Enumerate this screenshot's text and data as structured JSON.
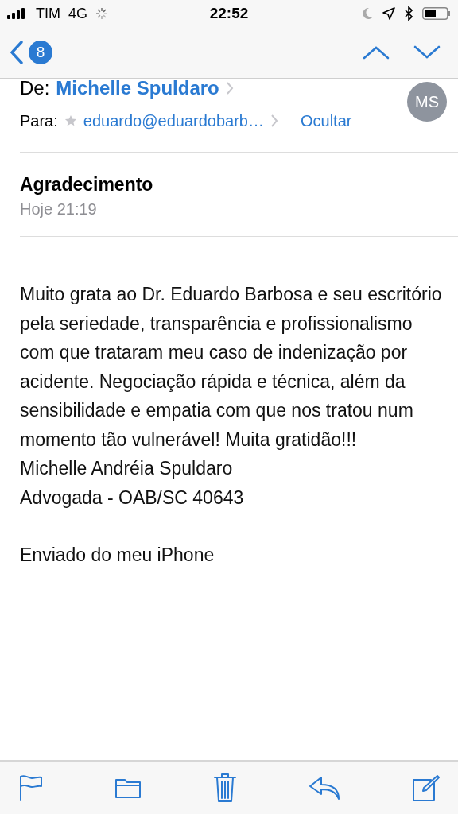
{
  "status_bar": {
    "carrier": "TIM",
    "network": "4G",
    "time": "22:52"
  },
  "nav": {
    "unread_count": "8"
  },
  "header": {
    "from_label": "De:",
    "from": "Michelle Spuldaro",
    "to_label": "Para:",
    "to": "eduardo@eduardobarb…",
    "hide": "Ocultar",
    "avatar": "MS",
    "subject": "Agradecimento",
    "date": "Hoje 21:19"
  },
  "body": {
    "paragraph": "Muito grata ao Dr. Eduardo Barbosa e seu escritório pela seriedade, transparência e profissionalismo com que trataram meu caso de indenização por acidente. Negociação rápida e técnica, além da sensibilidade e empatia com que nos tratou num momento tão vulnerável! Muita gratidão!!!",
    "signature": [
      "Michelle Andréia Spuldaro",
      "Advogada - OAB/SC 40643"
    ],
    "footer": "Enviado do meu iPhone"
  }
}
